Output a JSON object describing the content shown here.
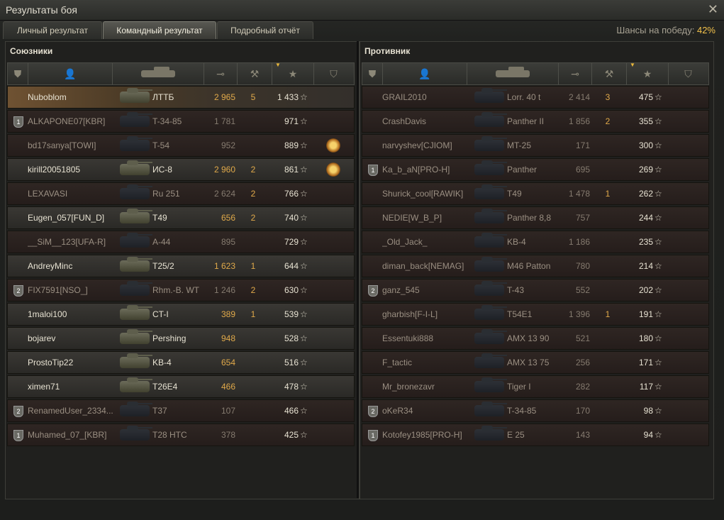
{
  "window": {
    "title": "Результаты боя"
  },
  "tabs": [
    "Личный результат",
    "Командный результат",
    "Подробный отчёт"
  ],
  "chance": {
    "label": "Шансы на победу:",
    "value": "42%"
  },
  "allies": {
    "title": "Союзники",
    "rows": [
      {
        "name": "Nuboblom",
        "tank": "ЛТТБ",
        "dmg": "2 965",
        "kills": "5",
        "xp": "1 433",
        "platoon": "",
        "medal": false,
        "dead": false,
        "me": true
      },
      {
        "name": "ALKAPONE07[KBR]",
        "tank": "T-34-85",
        "dmg": "1 781",
        "kills": "",
        "xp": "971",
        "platoon": "1",
        "medal": false,
        "dead": true,
        "me": false
      },
      {
        "name": "bd17sanya[TOWI]",
        "tank": "T-54",
        "dmg": "952",
        "kills": "",
        "xp": "889",
        "platoon": "",
        "medal": true,
        "dead": true,
        "me": false
      },
      {
        "name": "kirill20051805",
        "tank": "ИС-8",
        "dmg": "2 960",
        "kills": "2",
        "xp": "861",
        "platoon": "",
        "medal": true,
        "dead": false,
        "me": false
      },
      {
        "name": "LEXAVASI",
        "tank": "Ru 251",
        "dmg": "2 624",
        "kills": "2",
        "xp": "766",
        "platoon": "",
        "medal": false,
        "dead": true,
        "me": false
      },
      {
        "name": "Eugen_057[FUN_D]",
        "tank": "T49",
        "dmg": "656",
        "kills": "2",
        "xp": "740",
        "platoon": "",
        "medal": false,
        "dead": false,
        "me": false
      },
      {
        "name": "__SiM__123[UFA-R]",
        "tank": "A-44",
        "dmg": "895",
        "kills": "",
        "xp": "729",
        "platoon": "",
        "medal": false,
        "dead": true,
        "me": false
      },
      {
        "name": "AndreyMinc",
        "tank": "T25/2",
        "dmg": "1 623",
        "kills": "1",
        "xp": "644",
        "platoon": "",
        "medal": false,
        "dead": false,
        "me": false
      },
      {
        "name": "FIX7591[NSO_]",
        "tank": "Rhm.-B. WT",
        "dmg": "1 246",
        "kills": "2",
        "xp": "630",
        "platoon": "2",
        "medal": false,
        "dead": true,
        "me": false
      },
      {
        "name": "1maloi100",
        "tank": "CT-I",
        "dmg": "389",
        "kills": "1",
        "xp": "539",
        "platoon": "",
        "medal": false,
        "dead": false,
        "me": false
      },
      {
        "name": "bojarev",
        "tank": "Pershing",
        "dmg": "948",
        "kills": "",
        "xp": "528",
        "platoon": "",
        "medal": false,
        "dead": false,
        "me": false
      },
      {
        "name": "ProstoTip22",
        "tank": "KB-4",
        "dmg": "654",
        "kills": "",
        "xp": "516",
        "platoon": "",
        "medal": false,
        "dead": false,
        "me": false
      },
      {
        "name": "ximen71",
        "tank": "T26E4",
        "dmg": "466",
        "kills": "",
        "xp": "478",
        "platoon": "",
        "medal": false,
        "dead": false,
        "me": false
      },
      {
        "name": "RenamedUser_2334...",
        "tank": "T37",
        "dmg": "107",
        "kills": "",
        "xp": "466",
        "platoon": "2",
        "medal": false,
        "dead": true,
        "me": false
      },
      {
        "name": "Muhamed_07_[KBR]",
        "tank": "T28 HTC",
        "dmg": "378",
        "kills": "",
        "xp": "425",
        "platoon": "1",
        "medal": false,
        "dead": true,
        "me": false
      }
    ]
  },
  "enemies": {
    "title": "Противник",
    "rows": [
      {
        "name": "GRAIL2010",
        "tank": "Lorr. 40 t",
        "dmg": "2 414",
        "kills": "3",
        "xp": "475",
        "platoon": "",
        "medal": false,
        "dead": true,
        "me": false
      },
      {
        "name": "CrashDavis",
        "tank": "Panther II",
        "dmg": "1 856",
        "kills": "2",
        "xp": "355",
        "platoon": "",
        "medal": false,
        "dead": true,
        "me": false
      },
      {
        "name": "narvyshev[CJIOM]",
        "tank": "MT-25",
        "dmg": "171",
        "kills": "",
        "xp": "300",
        "platoon": "",
        "medal": false,
        "dead": true,
        "me": false
      },
      {
        "name": "Ka_b_aN[PRO-H]",
        "tank": "Panther",
        "dmg": "695",
        "kills": "",
        "xp": "269",
        "platoon": "1",
        "medal": false,
        "dead": true,
        "me": false
      },
      {
        "name": "Shurick_cool[RAWIK]",
        "tank": "T49",
        "dmg": "1 478",
        "kills": "1",
        "xp": "262",
        "platoon": "",
        "medal": false,
        "dead": true,
        "me": false
      },
      {
        "name": "NEDIE[W_B_P]",
        "tank": "Panther 8,8",
        "dmg": "757",
        "kills": "",
        "xp": "244",
        "platoon": "",
        "medal": false,
        "dead": true,
        "me": false
      },
      {
        "name": "_Old_Jack_",
        "tank": "KB-4",
        "dmg": "1 186",
        "kills": "",
        "xp": "235",
        "platoon": "",
        "medal": false,
        "dead": true,
        "me": false
      },
      {
        "name": "diman_back[NEMAG]",
        "tank": "M46 Patton",
        "dmg": "780",
        "kills": "",
        "xp": "214",
        "platoon": "",
        "medal": false,
        "dead": true,
        "me": false
      },
      {
        "name": "ganz_545",
        "tank": "T-43",
        "dmg": "552",
        "kills": "",
        "xp": "202",
        "platoon": "2",
        "medal": false,
        "dead": true,
        "me": false
      },
      {
        "name": "gharbish[F-I-L]",
        "tank": "T54E1",
        "dmg": "1 396",
        "kills": "1",
        "xp": "191",
        "platoon": "",
        "medal": false,
        "dead": true,
        "me": false
      },
      {
        "name": "Essentuki888",
        "tank": "AMX 13 90",
        "dmg": "521",
        "kills": "",
        "xp": "180",
        "platoon": "",
        "medal": false,
        "dead": true,
        "me": false
      },
      {
        "name": "F_tactic",
        "tank": "AMX 13 75",
        "dmg": "256",
        "kills": "",
        "xp": "171",
        "platoon": "",
        "medal": false,
        "dead": true,
        "me": false
      },
      {
        "name": "Mr_bronezavr",
        "tank": "Tiger I",
        "dmg": "282",
        "kills": "",
        "xp": "117",
        "platoon": "",
        "medal": false,
        "dead": true,
        "me": false
      },
      {
        "name": "oKeR34",
        "tank": "T-34-85",
        "dmg": "170",
        "kills": "",
        "xp": "98",
        "platoon": "2",
        "medal": false,
        "dead": true,
        "me": false
      },
      {
        "name": "Kotofey1985[PRO-H]",
        "tank": "E 25",
        "dmg": "143",
        "kills": "",
        "xp": "94",
        "platoon": "1",
        "medal": false,
        "dead": true,
        "me": false
      }
    ]
  },
  "icons": {
    "platoon": "shield-icon",
    "player": "player-icon",
    "vehicle": "tank-icon",
    "damage": "damage-icon",
    "kills": "kills-icon",
    "xp": "star-icon",
    "medal": "medal-icon",
    "sort": "sort-down-icon",
    "close": "close-icon"
  },
  "colors": {
    "win_chance": "#f3c24b",
    "damage": "#e0a94a",
    "me_row": "#6f5232"
  }
}
